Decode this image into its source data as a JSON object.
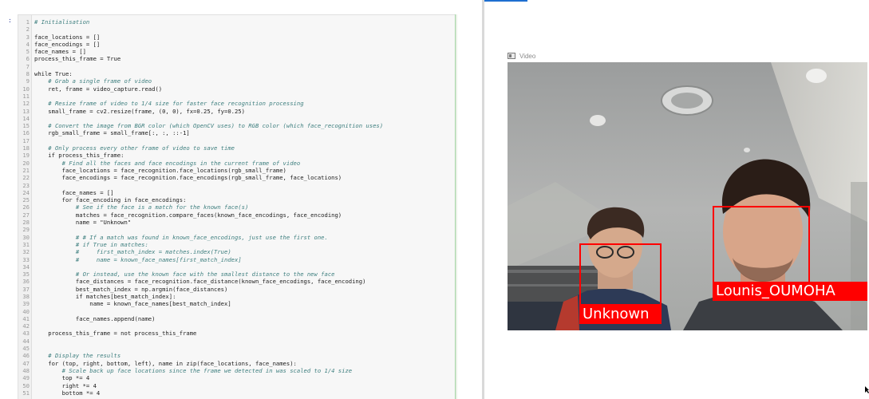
{
  "notebook": {
    "cell_prompt": ":",
    "lines": [
      {
        "n": "1",
        "text": "# Initialisation",
        "comment": true
      },
      {
        "n": "2",
        "text": ""
      },
      {
        "n": "3",
        "text": "face_locations = []"
      },
      {
        "n": "4",
        "text": "face_encodings = []"
      },
      {
        "n": "5",
        "text": "face_names = []"
      },
      {
        "n": "6",
        "text": "process_this_frame = True"
      },
      {
        "n": "7",
        "text": ""
      },
      {
        "n": "8",
        "text": "while True:"
      },
      {
        "n": "9",
        "text": "    # Grab a single frame of video",
        "comment": true
      },
      {
        "n": "10",
        "text": "    ret, frame = video_capture.read()"
      },
      {
        "n": "11",
        "text": ""
      },
      {
        "n": "12",
        "text": "    # Resize frame of video to 1/4 size for faster face recognition processing",
        "comment": true
      },
      {
        "n": "13",
        "text": "    small_frame = cv2.resize(frame, (0, 0), fx=0.25, fy=0.25)"
      },
      {
        "n": "14",
        "text": ""
      },
      {
        "n": "15",
        "text": "    # Convert the image from BGR color (which OpenCV uses) to RGB color (which face_recognition uses)",
        "comment": true
      },
      {
        "n": "16",
        "text": "    rgb_small_frame = small_frame[:, :, ::-1]"
      },
      {
        "n": "17",
        "text": ""
      },
      {
        "n": "18",
        "text": "    # Only process every other frame of video to save time",
        "comment": true
      },
      {
        "n": "19",
        "text": "    if process_this_frame:"
      },
      {
        "n": "20",
        "text": "        # Find all the faces and face encodings in the current frame of video",
        "comment": true
      },
      {
        "n": "21",
        "text": "        face_locations = face_recognition.face_locations(rgb_small_frame)"
      },
      {
        "n": "22",
        "text": "        face_encodings = face_recognition.face_encodings(rgb_small_frame, face_locations)"
      },
      {
        "n": "23",
        "text": ""
      },
      {
        "n": "24",
        "text": "        face_names = []"
      },
      {
        "n": "25",
        "text": "        for face_encoding in face_encodings:"
      },
      {
        "n": "26",
        "text": "            # See if the face is a match for the known face(s)",
        "comment": true
      },
      {
        "n": "27",
        "text": "            matches = face_recognition.compare_faces(known_face_encodings, face_encoding)"
      },
      {
        "n": "28",
        "text": "            name = \"Unknown\""
      },
      {
        "n": "29",
        "text": ""
      },
      {
        "n": "30",
        "text": "            # # If a match was found in known_face_encodings, just use the first one.",
        "comment": true
      },
      {
        "n": "31",
        "text": "            # if True in matches:",
        "comment": true
      },
      {
        "n": "32",
        "text": "            #     first_match_index = matches.index(True)",
        "comment": true
      },
      {
        "n": "33",
        "text": "            #     name = known_face_names[first_match_index]",
        "comment": true
      },
      {
        "n": "34",
        "text": ""
      },
      {
        "n": "35",
        "text": "            # Or instead, use the known face with the smallest distance to the new face",
        "comment": true
      },
      {
        "n": "36",
        "text": "            face_distances = face_recognition.face_distance(known_face_encodings, face_encoding)"
      },
      {
        "n": "37",
        "text": "            best_match_index = np.argmin(face_distances)"
      },
      {
        "n": "38",
        "text": "            if matches[best_match_index]:"
      },
      {
        "n": "39",
        "text": "                name = known_face_names[best_match_index]"
      },
      {
        "n": "40",
        "text": ""
      },
      {
        "n": "41",
        "text": "            face_names.append(name)"
      },
      {
        "n": "42",
        "text": ""
      },
      {
        "n": "43",
        "text": "    process_this_frame = not process_this_frame"
      },
      {
        "n": "44",
        "text": ""
      },
      {
        "n": "45",
        "text": ""
      },
      {
        "n": "46",
        "text": "    # Display the results",
        "comment": true
      },
      {
        "n": "47",
        "text": "    for (top, right, bottom, left), name in zip(face_locations, face_names):"
      },
      {
        "n": "48",
        "text": "        # Scale back up face locations since the frame we detected in was scaled to 1/4 size",
        "comment": true
      },
      {
        "n": "49",
        "text": "        top *= 4"
      },
      {
        "n": "50",
        "text": "        right *= 4"
      },
      {
        "n": "51",
        "text": "        bottom *= 4"
      }
    ]
  },
  "video_window": {
    "title": "Video",
    "icon": "window-icon",
    "faces": [
      {
        "label": "Unknown"
      },
      {
        "label": "Lounis_OUMOHA"
      }
    ],
    "box_color": "#ff0000"
  },
  "colors": {
    "comment": "#408080",
    "keyword": "#008000",
    "string": "#ba2121",
    "accent": "#1e6fd0"
  }
}
